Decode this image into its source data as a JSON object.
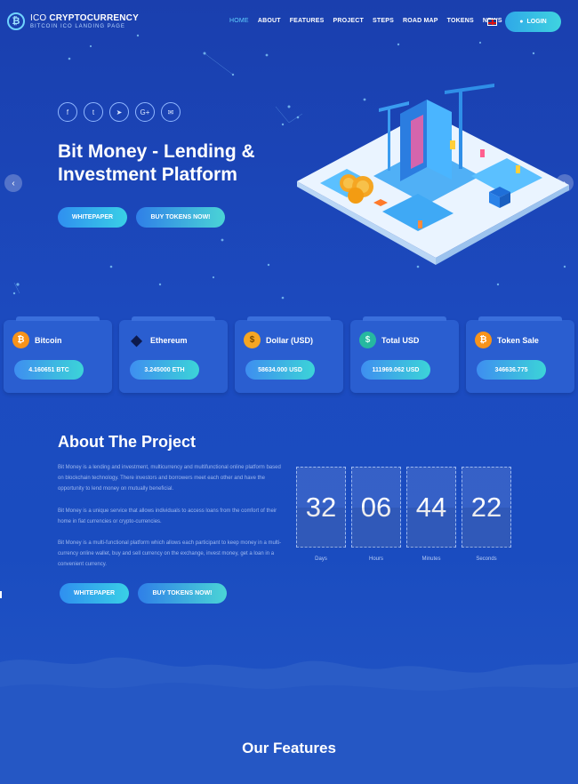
{
  "header": {
    "logo_letter": "₿",
    "logo_title_prefix": "ICO",
    "logo_title_main": "CRYPTOCURRENCY",
    "logo_subtitle": "BITCOIN ICO LANDING PAGE",
    "nav": [
      {
        "label": "HOME",
        "active": true
      },
      {
        "label": "ABOUT"
      },
      {
        "label": "FEATURES"
      },
      {
        "label": "PROJECT"
      },
      {
        "label": "STEPS"
      },
      {
        "label": "ROAD MAP"
      },
      {
        "label": "TOKENS"
      },
      {
        "label": "NEWS"
      }
    ],
    "login_label": "LOGIN"
  },
  "hero": {
    "social_icons": [
      "facebook-icon",
      "twitter-icon",
      "telegram-icon",
      "google-plus-icon",
      "mail-icon"
    ],
    "title_line1": "Bit Money - Lending &",
    "title_line2": "Investment Platform",
    "whitepaper_label": "WHITEPAPER",
    "buy_tokens_label": "BUY TOKENS NOW!"
  },
  "cards": [
    {
      "name": "Bitcoin",
      "value": "4.160651 BTC",
      "icon": "bitcoin-icon",
      "glyph": "₿",
      "color": "#f7931a"
    },
    {
      "name": "Ethereum",
      "value": "3.245000 ETH",
      "icon": "ethereum-icon",
      "glyph": "◆",
      "color": "#1a2a6a"
    },
    {
      "name": "Dollar (USD)",
      "value": "58634.000 USD",
      "icon": "dollar-icon",
      "glyph": "$",
      "color": "#f5a623"
    },
    {
      "name": "Total USD",
      "value": "111969.062 USD",
      "icon": "total-usd-icon",
      "glyph": "$",
      "color": "#26b8a0"
    },
    {
      "name": "Token Sale",
      "value": "346636.775",
      "icon": "token-sale-icon",
      "glyph": "₿",
      "color": "#f7931a"
    }
  ],
  "about": {
    "title": "About The Project",
    "p1": "Bit Money is a lending and investment, multicurrency and multifunctional online platform based on blockchain technology. There investors and borrowers meet each other and have the opportunity to lend money on mutually beneficial.",
    "p2": "Bit Money is a unique service that allows individuals to access loans from the comfort of their home in fiat currencies or crypto-currencies.",
    "p3": "Bit Money is a multi-functional platform which allows each participant to keep money in a multi-currency online wallet, buy and sell currency on the exchange, invest money, get a loan in a convenient currency.",
    "whitepaper_label": "WHITEPAPER",
    "buy_tokens_label": "BUY TOKENS NOW!"
  },
  "countdown": {
    "days": "32",
    "hours": "06",
    "minutes": "44",
    "seconds": "22",
    "days_label": "Days",
    "hours_label": "Hours",
    "minutes_label": "Minutes",
    "seconds_label": "Seconds"
  },
  "features": {
    "title": "Our Features"
  },
  "colors": {
    "accent": "#39d0e6",
    "background": "#1a47b8"
  }
}
